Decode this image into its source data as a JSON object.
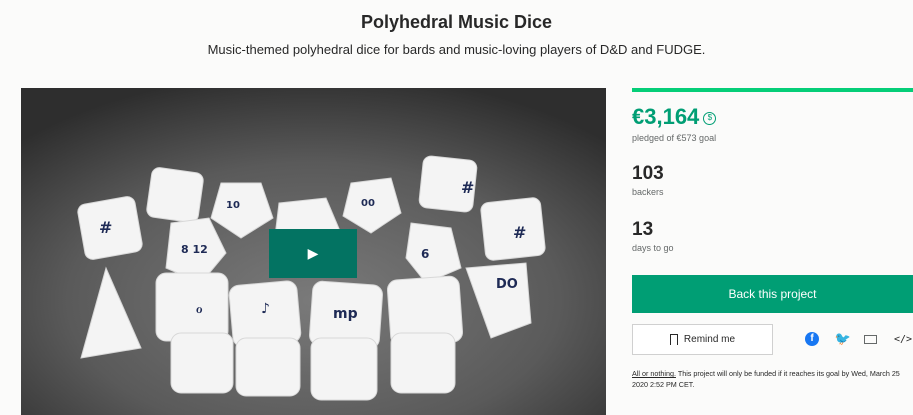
{
  "header": {
    "title": "Polyhedral Music Dice",
    "subtitle": "Music-themed polyhedral dice for bards and music-loving players of D&D and FUDGE."
  },
  "video": {
    "play_label": "▶"
  },
  "stats": {
    "pledged_amount": "€3,164",
    "currency_icon": "$",
    "goal_text": "pledged of €573 goal",
    "backers_count": "103",
    "backers_label": "backers",
    "days_count": "13",
    "days_label": "days to go",
    "funded_fraction": 1.0
  },
  "actions": {
    "back_label": "Back this project",
    "remind_label": "Remind me",
    "share_facebook_glyph": "f",
    "share_twitter_glyph": "🐦",
    "embed_glyph": "</>"
  },
  "fine_print": {
    "link_text": "All or nothing.",
    "text": " This project will only be funded if it reaches its goal by Wed, March 25 2020 2:52 PM CET."
  },
  "colors": {
    "accent": "#009e74",
    "accent_dark": "#037362",
    "progress": "#05ce78"
  }
}
